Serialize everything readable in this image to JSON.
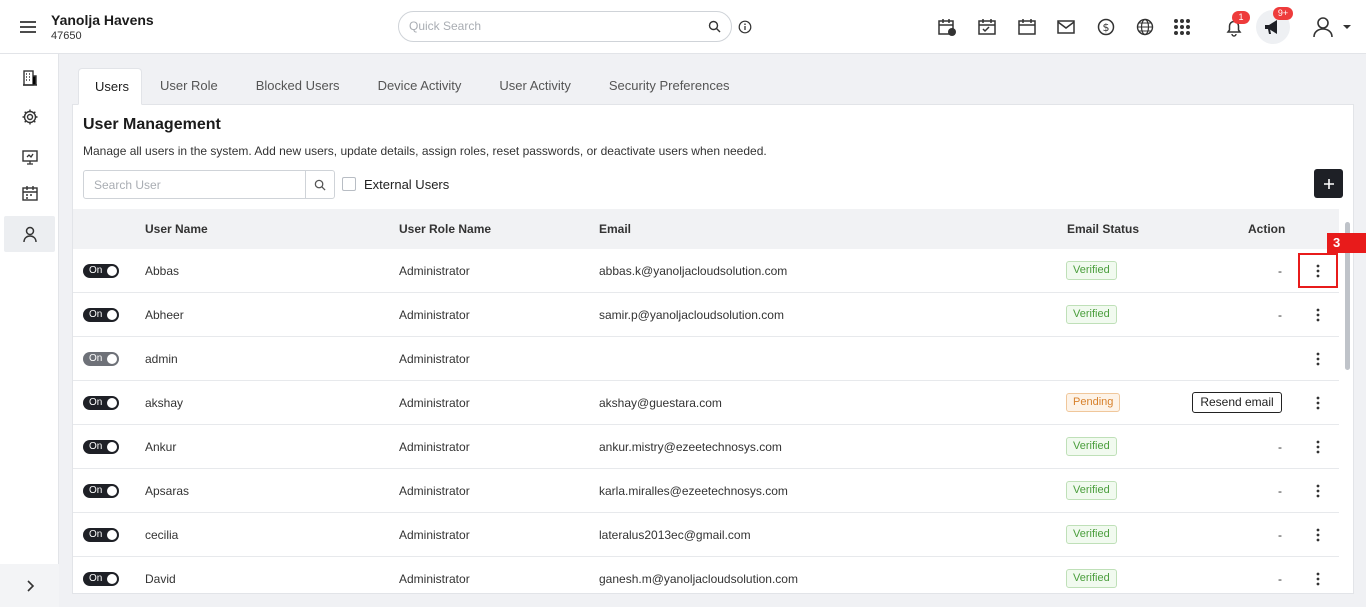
{
  "header": {
    "property_name": "Yanolja Havens",
    "property_id": "47650",
    "search_placeholder": "Quick Search",
    "notification_count": "1",
    "announcement_count": "9+"
  },
  "sidebar": {
    "items": [
      "building-icon",
      "gear-icon",
      "monitor-icon",
      "calendar-icon",
      "user-icon"
    ],
    "active": "user-icon"
  },
  "tabs": [
    "Users",
    "User Role",
    "Blocked Users",
    "Device Activity",
    "User Activity",
    "Security Preferences"
  ],
  "active_tab": "Users",
  "page": {
    "title": "User Management",
    "description": "Manage all users in the system. Add new users, update details, assign roles, reset passwords, or deactivate users when needed.",
    "search_placeholder": "Search User",
    "external_users_label": "External Users"
  },
  "table": {
    "headers": {
      "user_name": "User Name",
      "role": "User Role Name",
      "email": "Email",
      "status": "Email Status",
      "action": "Action"
    },
    "rows": [
      {
        "toggle": "On",
        "name": "Abbas",
        "role": "Administrator",
        "email": "abbas.k@yanoljacloudsolution.com",
        "status": "Verified",
        "action": "-"
      },
      {
        "toggle": "On",
        "name": "Abheer",
        "role": "Administrator",
        "email": "samir.p@yanoljacloudsolution.com",
        "status": "Verified",
        "action": "-"
      },
      {
        "toggle": "On",
        "name": "admin",
        "role": "Administrator",
        "email": "",
        "status": "",
        "action": ""
      },
      {
        "toggle": "On",
        "name": "akshay",
        "role": "Administrator",
        "email": "akshay@guestara.com",
        "status": "Pending",
        "action": "Resend email"
      },
      {
        "toggle": "On",
        "name": "Ankur",
        "role": "Administrator",
        "email": "ankur.mistry@ezeetechnosys.com",
        "status": "Verified",
        "action": "-"
      },
      {
        "toggle": "On",
        "name": "Apsaras",
        "role": "Administrator",
        "email": "karla.miralles@ezeetechnosys.com",
        "status": "Verified",
        "action": "-"
      },
      {
        "toggle": "On",
        "name": "cecilia",
        "role": "Administrator",
        "email": "lateralus2013ec@gmail.com",
        "status": "Verified",
        "action": "-"
      },
      {
        "toggle": "On",
        "name": "David",
        "role": "Administrator",
        "email": "ganesh.m@yanoljacloudsolution.com",
        "status": "Verified",
        "action": "-"
      }
    ]
  },
  "annotation": {
    "label": "3"
  },
  "colors": {
    "accent_dark": "#1e2026",
    "verified": "#4a9e3c",
    "pending": "#d7812c",
    "alert": "#e81b1b"
  }
}
